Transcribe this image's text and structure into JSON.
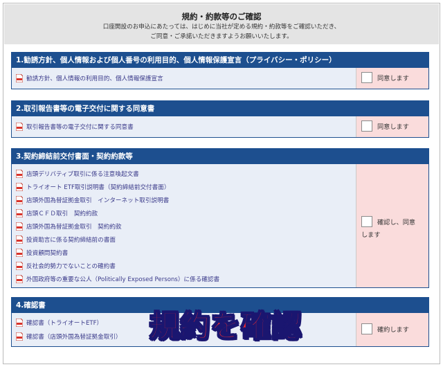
{
  "header": {
    "title": "規約・約款等のご確認",
    "intro_line1": "口座開設のお申込にあたっては、はじめに当社が定める規約・約款等をご確認いただき、",
    "intro_line2": "ご同意・ご承諾いただきますようお願いいたします。"
  },
  "icons": {
    "document": "pdf-icon",
    "checkbox": "checkbox-icon"
  },
  "colors": {
    "section_header": "#1d4f8f",
    "agree_panel": "#fadcdc",
    "body_panel": "#e9eef7",
    "overlay_text": "#ff2a2a",
    "overlay_outline": "#1a1670"
  },
  "sections": [
    {
      "title": "1.勧誘方針、個人情報および個人番号の利用目的、個人情報保護宣言（プライバシー・ポリシー）",
      "docs": [
        "勧誘方針、個人情報の利用目的、個人情報保護宣言"
      ],
      "agree_label": "同意します"
    },
    {
      "title": "2.取引報告書等の電子交付に関する同意書",
      "docs": [
        "取引報告書等の電子交付に関する同意書"
      ],
      "agree_label": "同意します"
    },
    {
      "title": "3.契約締結前交付書面・契約約款等",
      "docs": [
        "店頭デリバティブ取引に係る注意喚起文書",
        "トライオート ETF取引説明書（契約締結前交付書面）",
        "店頭外国為替証拠金取引　インターネット取引説明書",
        "店頭ＣＦＤ取引　契約約款",
        "店頭外国為替証拠金取引　契約約款",
        "投資助言に係る契約締結前の書面",
        "投資顧問契約書",
        "反社会的勢力でないことの確約書",
        "外国政府等の重要な公人（Politically Exposed Persons）に係る確認書"
      ],
      "agree_label_line1": "確認し、同意",
      "agree_label_line2": "します"
    },
    {
      "title": "4.確認書",
      "docs": [
        "確認書（トライオートETF）",
        "確認書（店頭外国為替証拠金取引）"
      ],
      "agree_label": "確約します"
    }
  ],
  "overlay_caption": "規約を確認"
}
